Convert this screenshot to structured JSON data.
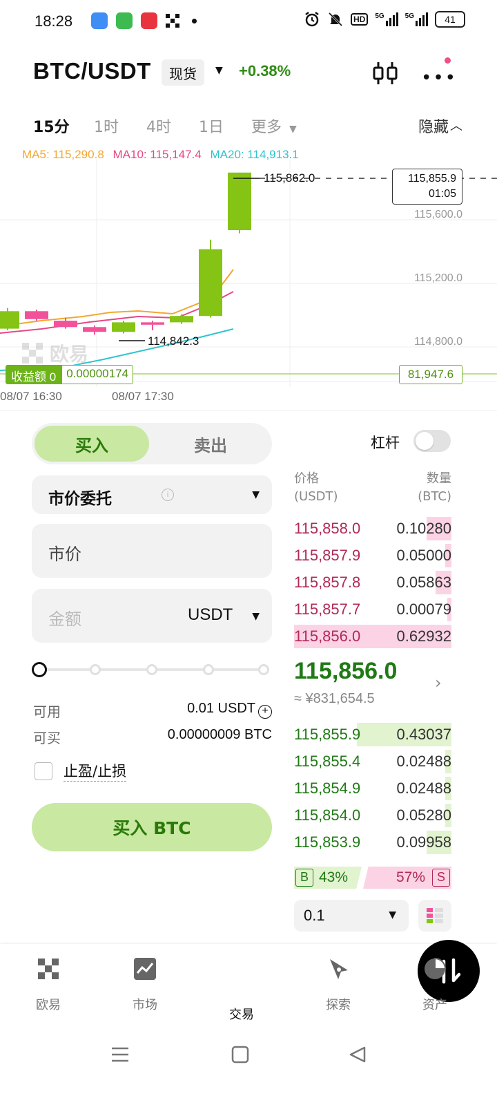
{
  "status_bar": {
    "time": "18:28",
    "hd": "HD",
    "net1": "5G",
    "net2": "5G",
    "battery": "41"
  },
  "header": {
    "pair": "BTC/USDT",
    "market_type": "现货",
    "change": "+0.38%"
  },
  "timeframes": {
    "tabs": [
      "15分",
      "1时",
      "4时",
      "1日",
      "更多"
    ],
    "active": "15分",
    "hide_label": "隐藏"
  },
  "chart_data": {
    "type": "candlestick",
    "ma": {
      "ma5_label": "MA5: 115,290.8",
      "ma10_label": "MA10: 115,147.4",
      "ma20_label": "MA20: 114,913.1"
    },
    "current_price_box": {
      "price": "115,855.9",
      "countdown": "01:05"
    },
    "high_label": "115,862.0",
    "low_label": "114,842.3",
    "y_ticks": [
      "115,600.0",
      "115,200.0",
      "114,800.0"
    ],
    "x_ticks": [
      "08/07 16:30",
      "08/07 17:30"
    ],
    "pnl_label": "收益额 0",
    "pnl_value": "0.00000174",
    "pnl_right_value": "81,947.6",
    "watermark": "欧易",
    "candles": [
      {
        "open": 114880,
        "close": 114990,
        "high": 115010,
        "low": 114870,
        "dir": "up"
      },
      {
        "open": 114990,
        "close": 114940,
        "high": 115000,
        "low": 114930,
        "dir": "down"
      },
      {
        "open": 114930,
        "close": 114890,
        "high": 114950,
        "low": 114880,
        "dir": "down"
      },
      {
        "open": 114890,
        "close": 114860,
        "high": 114900,
        "low": 114842.3,
        "dir": "down"
      },
      {
        "open": 114860,
        "close": 114920,
        "high": 114930,
        "low": 114850,
        "dir": "up"
      },
      {
        "open": 114920,
        "close": 114905,
        "high": 114930,
        "low": 114870,
        "dir": "down"
      },
      {
        "open": 114920,
        "close": 114960,
        "high": 114970,
        "low": 114910,
        "dir": "up"
      },
      {
        "open": 114960,
        "close": 115380,
        "high": 115440,
        "low": 114950,
        "dir": "up"
      },
      {
        "open": 115500,
        "close": 115862,
        "high": 115862,
        "low": 115480,
        "dir": "up"
      }
    ]
  },
  "trade_form": {
    "buy_label": "买入",
    "sell_label": "卖出",
    "leverage_label": "杠杆",
    "order_type": "市价委托",
    "price_field": "市价",
    "amount_placeholder": "金额",
    "amount_unit": "USDT",
    "available_label": "可用",
    "available_value": "0.01 USDT",
    "can_buy_label": "可买",
    "can_buy_value": "0.00000009 BTC",
    "tpsl_label": "止盈/止损",
    "submit_label": "买入 BTC",
    "slider_position": 0
  },
  "order_book": {
    "price_header": "价格",
    "price_unit": "(USDT)",
    "qty_header": "数量",
    "qty_unit": "(BTC)",
    "asks": [
      {
        "price": "115,858.0",
        "qty": "0.10280",
        "depth": 0.16
      },
      {
        "price": "115,857.9",
        "qty": "0.05000",
        "depth": 0.04
      },
      {
        "price": "115,857.8",
        "qty": "0.05863",
        "depth": 0.1
      },
      {
        "price": "115,857.7",
        "qty": "0.00079",
        "depth": 0.02
      },
      {
        "price": "115,856.0",
        "qty": "0.62932",
        "depth": 1.0
      }
    ],
    "last_price": "115,856.0",
    "last_price_cny": "≈ ¥831,654.5",
    "bids": [
      {
        "price": "115,855.9",
        "qty": "0.43037",
        "depth": 0.6
      },
      {
        "price": "115,855.4",
        "qty": "0.02488",
        "depth": 0.04
      },
      {
        "price": "115,854.9",
        "qty": "0.02488",
        "depth": 0.04
      },
      {
        "price": "115,854.0",
        "qty": "0.05280",
        "depth": 0.04
      },
      {
        "price": "115,853.9",
        "qty": "0.09958",
        "depth": 0.16
      }
    ],
    "buy_badge": "B",
    "buy_pct": "43%",
    "sell_pct": "57%",
    "sell_badge": "S",
    "depth_value": "0.1"
  },
  "bottom_nav": {
    "items": [
      "欧易",
      "市场",
      "交易",
      "探索",
      "资产"
    ],
    "active": "交易"
  },
  "colors": {
    "up": "#85c414",
    "down": "#f2529a",
    "ma5": "#f2a830",
    "ma10": "#e54785",
    "ma20": "#2fc4cf",
    "buy_green": "#1f7a14",
    "sell_red": "#b02a55"
  }
}
